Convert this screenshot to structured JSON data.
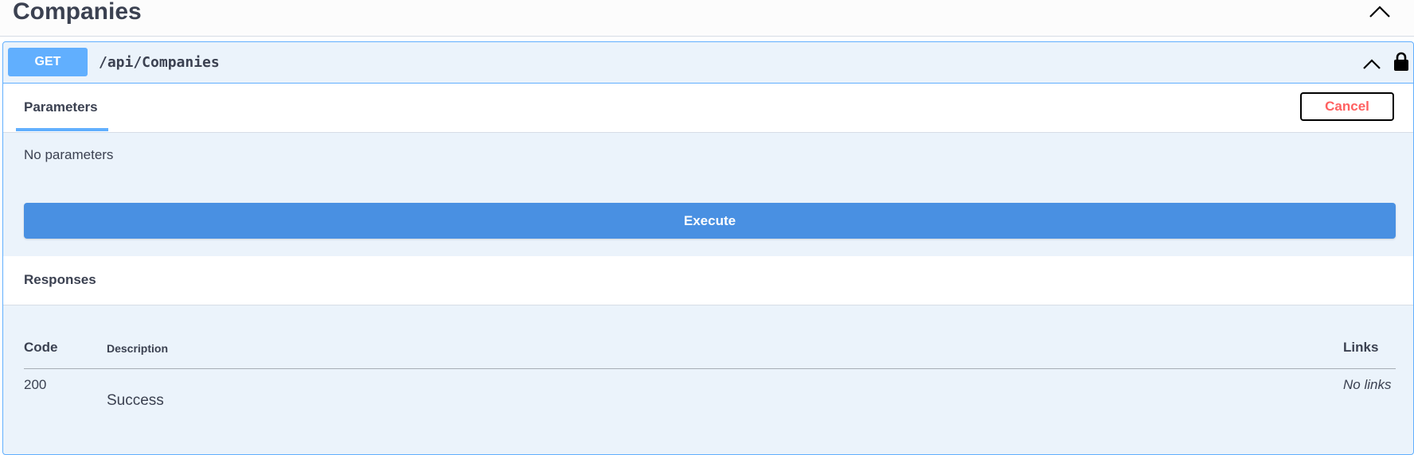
{
  "section": {
    "title": "Companies"
  },
  "operation": {
    "method": "GET",
    "path": "/api/Companies",
    "method_color": "#61affe",
    "parameters_tab": "Parameters",
    "cancel_label": "Cancel",
    "no_parameters": "No parameters",
    "execute_label": "Execute",
    "execute_color": "#4990e2"
  },
  "responses": {
    "title": "Responses",
    "headers": {
      "code": "Code",
      "description": "Description",
      "links": "Links"
    },
    "rows": [
      {
        "code": "200",
        "description": "Success",
        "links": "No links"
      }
    ]
  },
  "icons": {
    "section_toggle": "chevron-up-icon",
    "operation_toggle": "chevron-up-icon",
    "authorization": "lock-icon"
  }
}
